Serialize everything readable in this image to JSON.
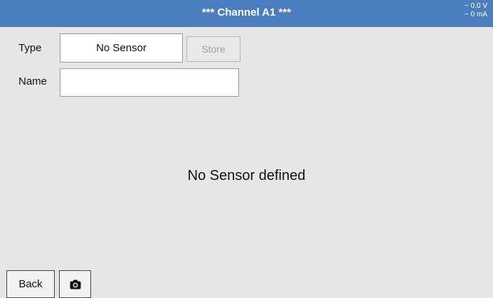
{
  "header": {
    "title": "*** Channel A1 ***",
    "voltage": "~ 0.0 V",
    "current": "~ 0 mA"
  },
  "form": {
    "type_label": "Type",
    "type_value": "No Sensor",
    "store_label": "Store",
    "name_label": "Name",
    "name_value": ""
  },
  "main": {
    "message": "No Sensor defined"
  },
  "footer": {
    "back_label": "Back",
    "camera_icon": "camera-icon"
  },
  "colors": {
    "titlebar": "#4a7ebf",
    "background": "#e6e6e6"
  }
}
